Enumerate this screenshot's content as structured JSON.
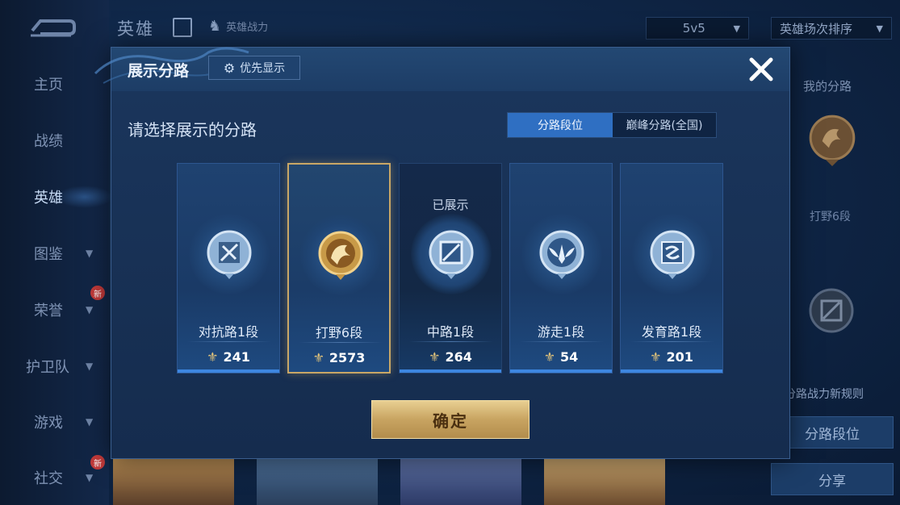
{
  "sidebar": {
    "items": [
      {
        "label": "主页"
      },
      {
        "label": "战绩"
      },
      {
        "label": "英雄"
      },
      {
        "label": "图鉴"
      },
      {
        "label": "荣誉",
        "badge": "新"
      },
      {
        "label": "护卫队"
      },
      {
        "label": "游戏"
      },
      {
        "label": "社交",
        "badge": "新"
      }
    ]
  },
  "topbar": {
    "title": "英雄",
    "power_label": "英雄战力",
    "mode_select": "5v5",
    "sort_select": "英雄场次排序"
  },
  "right_panel": {
    "my_lanes_label": "我的分路",
    "rank_text": "打野6段",
    "rule_text": "分路战力新规则",
    "lane_rank_button": "分路段位",
    "share_button": "分享"
  },
  "modal": {
    "title": "展示分路",
    "priority_button": "优先显示",
    "prompt": "请选择展示的分路",
    "tabs": [
      "分路段位",
      "巅峰分路(全国)"
    ],
    "selected_tab": "分路段位",
    "cards": [
      {
        "rank": "对抗路1段",
        "score": "241",
        "shown": "",
        "selected": false,
        "dim": false,
        "icon": "clash-lane-icon"
      },
      {
        "rank": "打野6段",
        "score": "2573",
        "shown": "",
        "selected": true,
        "dim": false,
        "icon": "jungle-dragon-icon"
      },
      {
        "rank": "中路1段",
        "score": "264",
        "shown": "已展示",
        "selected": false,
        "dim": true,
        "icon": "mid-lane-icon"
      },
      {
        "rank": "游走1段",
        "score": "54",
        "shown": "",
        "selected": false,
        "dim": false,
        "icon": "roam-wings-icon"
      },
      {
        "rank": "发育路1段",
        "score": "201",
        "shown": "",
        "selected": false,
        "dim": false,
        "icon": "farm-lane-icon"
      }
    ],
    "confirm_button": "确定"
  },
  "colors": {
    "accent_blue": "#2f6fc2",
    "gold": "#c8a461",
    "panel": "#1a355b"
  }
}
